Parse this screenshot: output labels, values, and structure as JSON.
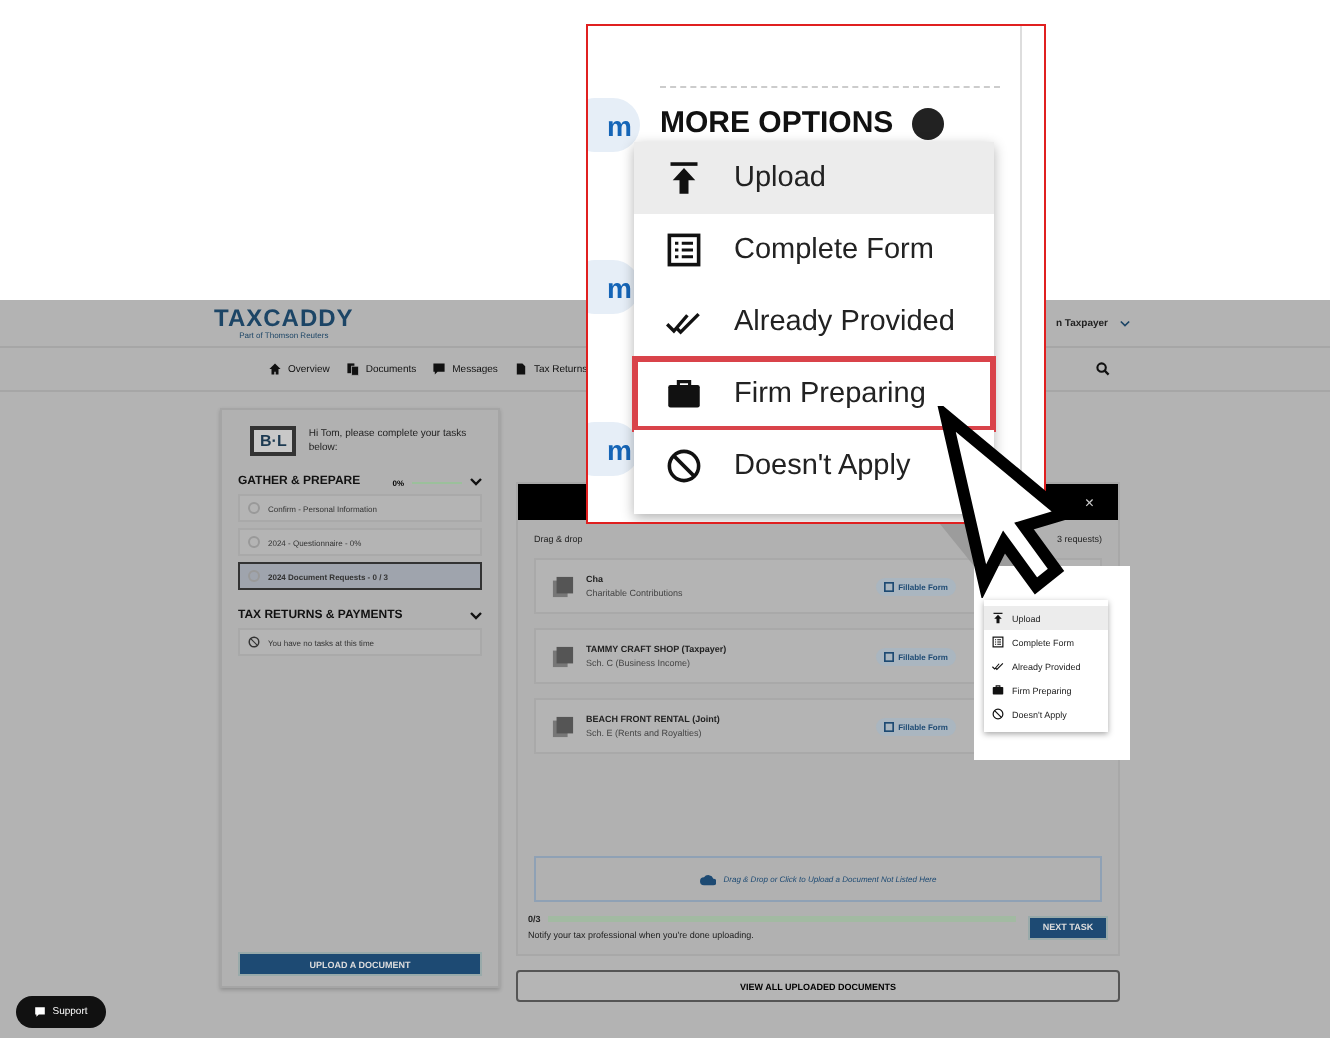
{
  "header": {
    "logo": "TAXCADDY",
    "logo_sub": "Part of Thomson Reuters",
    "user": "n Taxpayer"
  },
  "nav": [
    {
      "label": "Overview",
      "kind": "home"
    },
    {
      "label": "Documents",
      "kind": "documents"
    },
    {
      "label": "Messages",
      "kind": "messages"
    },
    {
      "label": "Tax Returns",
      "kind": "returns"
    }
  ],
  "tasks_panel": {
    "firm_logo": "B·L",
    "greeting": "Hi Tom, please complete your tasks below:",
    "sections": [
      {
        "title": "GATHER & PREPARE",
        "percent": "0%",
        "level": 0,
        "items": [
          {
            "label": "Confirm - Personal Information",
            "selected": false,
            "kind": "task"
          },
          {
            "label": "2024 - Questionnaire - 0%",
            "selected": false,
            "kind": "task"
          },
          {
            "label": "2024 Document Requests - 0 / 3",
            "selected": true,
            "kind": "task"
          }
        ]
      },
      {
        "title": "TAX RETURNS & PAYMENTS",
        "items": [
          {
            "label": "You have no tasks at this time",
            "selected": false,
            "kind": "empty"
          }
        ]
      }
    ],
    "upload_button": "UPLOAD A DOCUMENT"
  },
  "request_panel": {
    "instructions": "Drag & drop",
    "request_count": "3 requests)",
    "close": "×",
    "rows": [
      {
        "title": "Cha",
        "subtitle": "Charitable Contributions",
        "action": "Fillable Form"
      },
      {
        "title": "TAMMY CRAFT SHOP (Taxpayer)",
        "subtitle": "Sch. C (Business Income)",
        "action": "Fillable Form"
      },
      {
        "title": "BEACH FRONT RENTAL (Joint)",
        "subtitle": "Sch. E (Rents and Royalties)",
        "action": "Fillable Form"
      }
    ],
    "dropzone": "Drag & Drop or Click to Upload a Document Not Listed Here",
    "progress": "0/3",
    "level": 0,
    "note": "Notify your tax professional when you're done uploading.",
    "next_button": "NEXT TASK",
    "view_all_button": "VIEW ALL UPLOADED DOCUMENTS"
  },
  "small_menu": {
    "items": [
      {
        "label": "Upload",
        "kind": "upload",
        "hovered": true
      },
      {
        "label": "Complete Form",
        "kind": "form",
        "hovered": false
      },
      {
        "label": "Already Provided",
        "kind": "provided",
        "hovered": false
      },
      {
        "label": "Firm Preparing",
        "kind": "briefcase",
        "hovered": false
      },
      {
        "label": "Doesn't Apply",
        "kind": "none",
        "hovered": false
      }
    ]
  },
  "zoom_callout": {
    "pills": [
      "m",
      "m",
      "m"
    ],
    "title": "MORE OPTIONS",
    "items": [
      {
        "label": "Upload",
        "kind": "upload",
        "hovered": true,
        "highlighted": false
      },
      {
        "label": "Complete Form",
        "kind": "form",
        "hovered": false,
        "highlighted": false
      },
      {
        "label": "Already Provided",
        "kind": "provided",
        "hovered": false,
        "highlighted": false
      },
      {
        "label": "Firm Preparing",
        "kind": "briefcase",
        "hovered": false,
        "highlighted": true
      },
      {
        "label": "Doesn't Apply",
        "kind": "none",
        "hovered": false,
        "highlighted": false
      }
    ]
  },
  "support_button": "Support"
}
